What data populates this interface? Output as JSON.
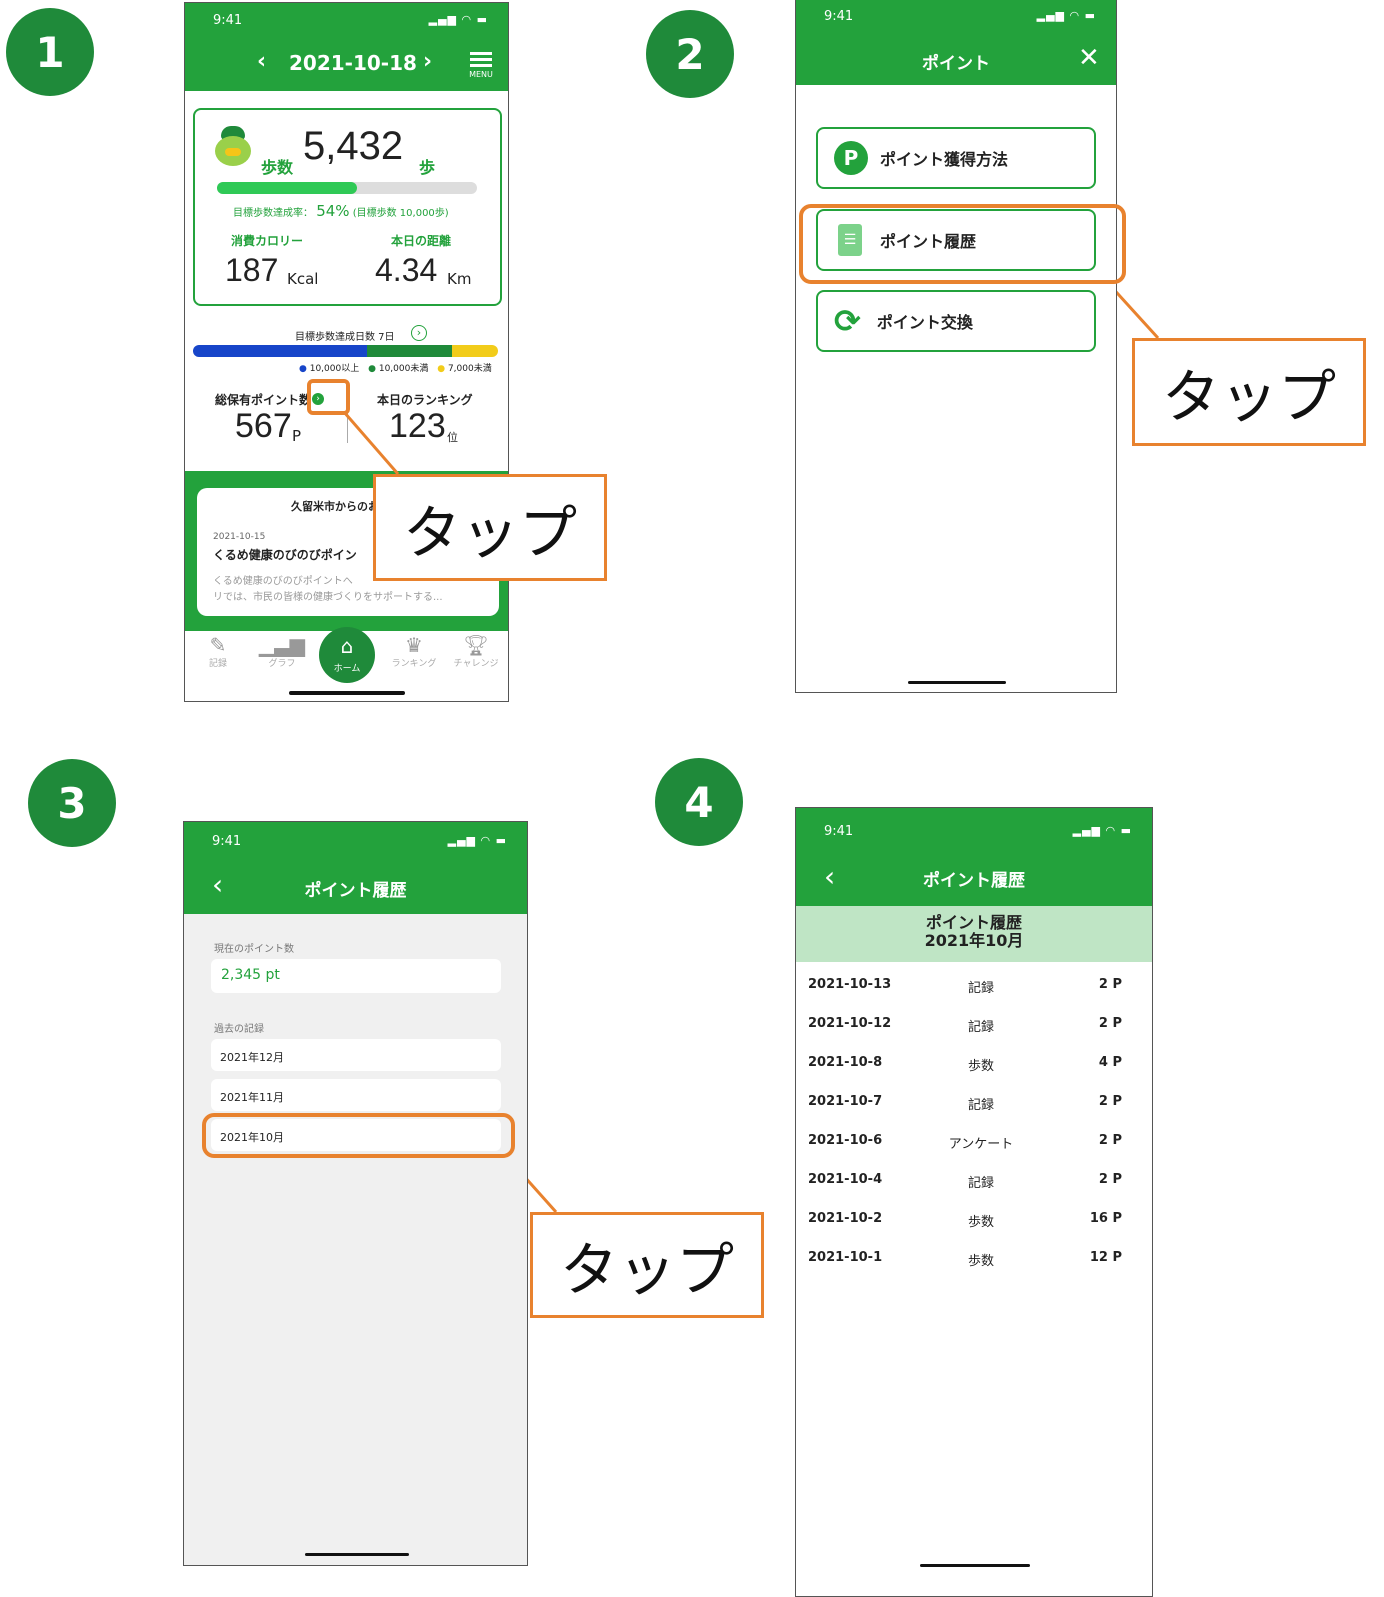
{
  "steps": [
    "1",
    "2",
    "3",
    "4"
  ],
  "callout_text": "タップ",
  "screen1": {
    "time": "9:41",
    "date": "2021-10-18",
    "menu_label": "MENU",
    "steps_label": "歩数",
    "steps_value": "5,432",
    "steps_unit": "歩",
    "progress_fraction": 0.54,
    "goal_rate_label": "目標歩数達成率：",
    "goal_rate_value": "54%",
    "goal_note": "(目標歩数 10,000歩)",
    "calorie_label": "消費カロリー",
    "calorie_value": "187",
    "calorie_unit": "Kcal",
    "distance_label": "本日の距離",
    "distance_value": "4.34",
    "distance_unit": "Km",
    "goal_days": "目標歩数達成日数 7日",
    "legend": [
      "10,000以上",
      "10,000未満",
      "7,000未満"
    ],
    "legend_colors": [
      "#1745c9",
      "#1f8a3a",
      "#f2cc1a"
    ],
    "points_label": "総保有ポイント数",
    "points_value": "567",
    "points_unit": "P",
    "ranking_label": "本日のランキング",
    "ranking_value": "123",
    "ranking_unit": "位",
    "news_header": "久留米市からのお",
    "news_date": "2021-10-15",
    "news_title": "くるめ健康のびのびポイン",
    "news_body1": "くるめ健康のびのびポイントへ",
    "news_body2": "リでは、市民の皆様の健康づくりをサポートする...",
    "tabs": [
      "記録",
      "グラフ",
      "ホーム",
      "ランキング",
      "チャレンジ"
    ]
  },
  "screen2": {
    "time": "9:41",
    "title": "ポイント",
    "items": [
      "ポイント獲得方法",
      "ポイント履歴",
      "ポイント交換"
    ]
  },
  "screen3": {
    "time": "9:41",
    "title": "ポイント履歴",
    "current_label": "現在のポイント数",
    "current_value": "2,345 pt",
    "past_label": "過去の記録",
    "months": [
      "2021年12月",
      "2021年11月",
      "2021年10月"
    ]
  },
  "screen4": {
    "time": "9:41",
    "title": "ポイント履歴",
    "subtitle1": "ポイント履歴",
    "subtitle2": "2021年10月",
    "rows": [
      {
        "date": "2021-10-13",
        "type": "記録",
        "points": "2 P"
      },
      {
        "date": "2021-10-12",
        "type": "記録",
        "points": "2 P"
      },
      {
        "date": "2021-10-8",
        "type": "歩数",
        "points": "4 P"
      },
      {
        "date": "2021-10-7",
        "type": "記録",
        "points": "2 P"
      },
      {
        "date": "2021-10-6",
        "type": "アンケート",
        "points": "2 P"
      },
      {
        "date": "2021-10-4",
        "type": "記録",
        "points": "2 P"
      },
      {
        "date": "2021-10-2",
        "type": "歩数",
        "points": "16 P"
      },
      {
        "date": "2021-10-1",
        "type": "歩数",
        "points": "12 P"
      }
    ]
  }
}
